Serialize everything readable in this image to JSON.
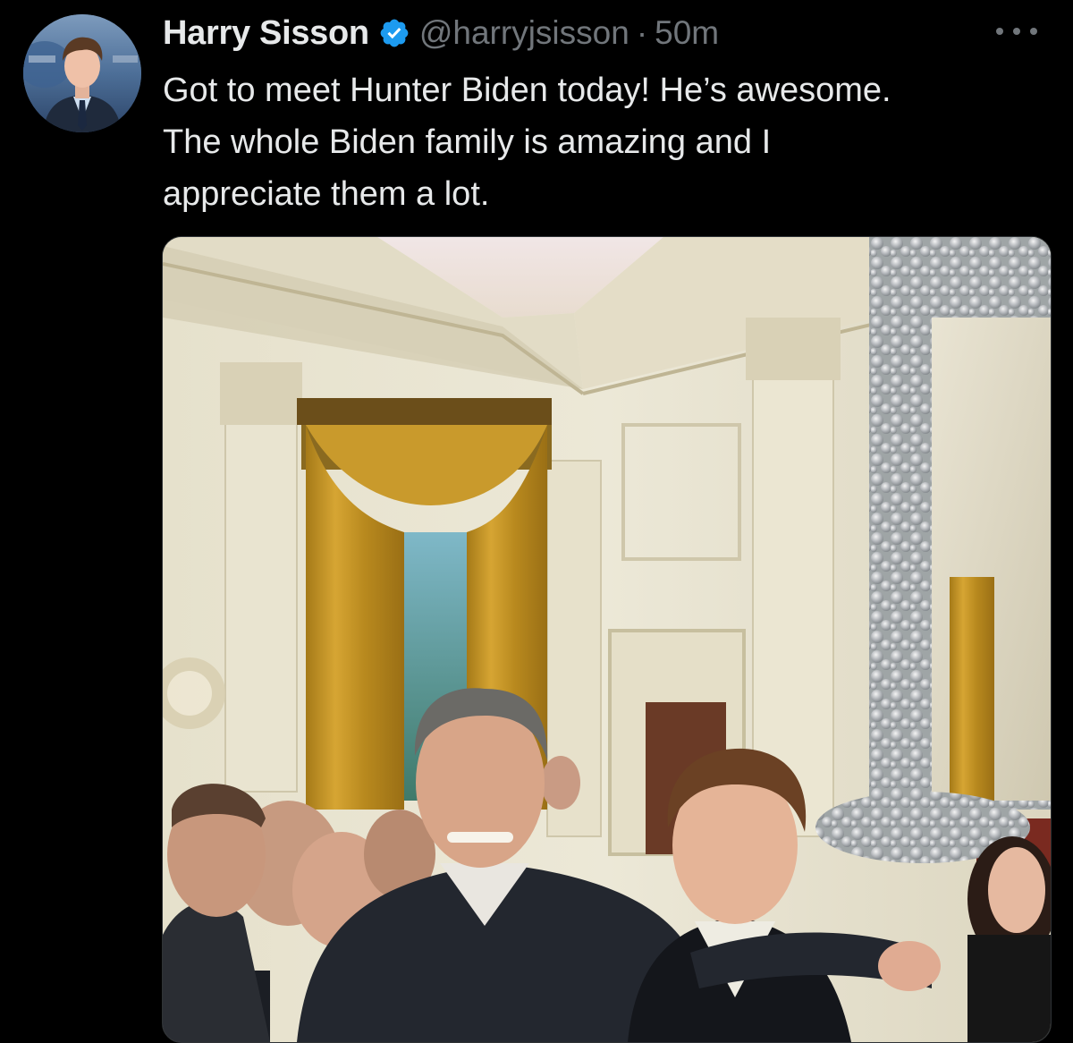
{
  "tweet": {
    "author": {
      "display_name": "Harry Sisson",
      "handle": "@harryjsisson",
      "verified": true,
      "avatar_icon": "user-avatar"
    },
    "separator": "·",
    "timestamp": "50m",
    "more_icon": "more-horizontal-icon",
    "text_lines": [
      "Got to meet Hunter Biden today! He’s awesome.",
      "The whole Biden family is amazing and I",
      "appreciate them a lot."
    ],
    "media": {
      "type": "photo",
      "alt": "Photo of Harry Sisson and Hunter Biden in the White House East Room"
    }
  },
  "colors": {
    "background": "#000000",
    "text_primary": "#e7e9ea",
    "text_secondary": "#71767b",
    "verified_blue": "#1d9bf0"
  }
}
